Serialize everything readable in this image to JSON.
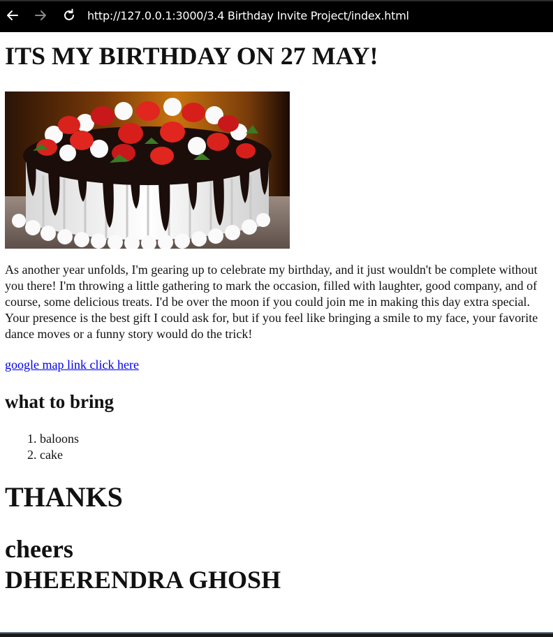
{
  "browser": {
    "url": "http://127.0.0.1:3000/3.4 Birthday Invite Project/index.html",
    "icons": {
      "back": "back-arrow-icon",
      "forward": "forward-arrow-icon",
      "reload": "reload-icon"
    }
  },
  "page": {
    "heading": "ITS MY BIRTHDAY ON 27 MAY!",
    "image_subject": "cake",
    "paragraph": "As another year unfolds, I'm gearing up to celebrate my birthday, and it just wouldn't be complete without you there! I'm throwing a little gathering to mark the occasion, filled with laughter, good company, and of course, some delicious treats. I'd be over the moon if you could join me in making this day extra special. Your presence is the best gift I could ask for, but if you feel like bringing a smile to my face, your favorite dance moves or a funny story would do the trick!",
    "map_link": "google map link click here",
    "bring_heading": "what to bring",
    "bring_items": [
      "baloons",
      "cake"
    ],
    "thanks": "THANKS",
    "signoff": "cheers",
    "name": "DHEERENDRA GHOSH"
  },
  "colors": {
    "titlebar": "#000000",
    "link": "#0000ee",
    "text": "#111111"
  }
}
